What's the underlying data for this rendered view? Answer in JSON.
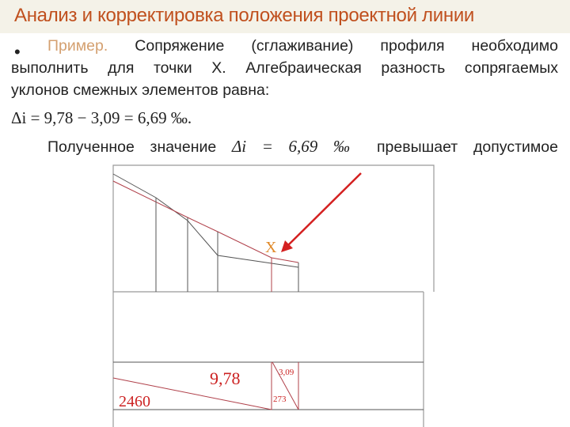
{
  "title": "Анализ и корректировка положения проектной линии",
  "body": {
    "bullet": "•",
    "lead": "Пример.",
    "line1_rest": "Сопряжение (сглаживание) профиля необходимо",
    "line2": "выполнить для точки Х. Алгебраическая разность сопрягаемых",
    "line3": "уклонов смежных элементов равна:",
    "formula": "Δi = 9,78 − 3,09 = 6,69 ‰.",
    "line5_a": "Полученное значение",
    "line5_formula": "Δi = 6,69 ‰",
    "line5_b": "превышает допустимое"
  },
  "drawing": {
    "point_label": "X",
    "slope_left": "9,78",
    "slope_right": "3,09",
    "length_left": "2460",
    "length_right": "273",
    "colors": {
      "title": "#c0501e",
      "labels": "#cc2222",
      "point": "#e08a2a",
      "arrow": "#d42020"
    }
  }
}
